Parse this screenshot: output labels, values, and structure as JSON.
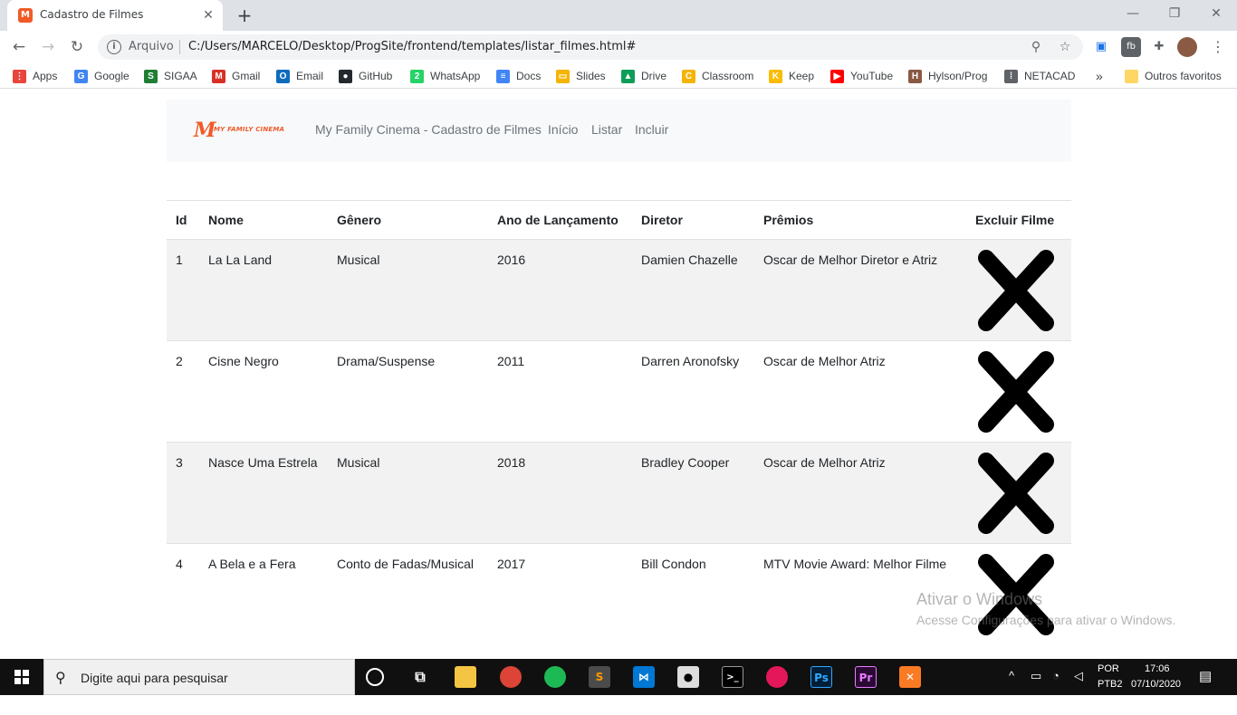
{
  "browser": {
    "tab_title": "Cadastro de Filmes",
    "tab_close": "✕",
    "new_tab": "+",
    "omnibox_scheme": "Arquivo",
    "url": "C:/Users/MARCELO/Desktop/ProgSite/frontend/templates/listar_filmes.html#",
    "bookmarks": [
      {
        "label": "Apps",
        "color": "#e8453c",
        "glyph": "⋮"
      },
      {
        "label": "Google",
        "color": "#4285f4",
        "glyph": "G"
      },
      {
        "label": "SIGAA",
        "color": "#1e7e34",
        "glyph": "S"
      },
      {
        "label": "Gmail",
        "color": "#d93025",
        "glyph": "M"
      },
      {
        "label": "Email",
        "color": "#0f6cbd",
        "glyph": "O"
      },
      {
        "label": "GitHub",
        "color": "#24292e",
        "glyph": "●"
      },
      {
        "label": "WhatsApp",
        "color": "#25d366",
        "glyph": "2"
      },
      {
        "label": "Docs",
        "color": "#4285f4",
        "glyph": "≡"
      },
      {
        "label": "Slides",
        "color": "#f4b400",
        "glyph": "▭"
      },
      {
        "label": "Drive",
        "color": "#0f9d58",
        "glyph": "▲"
      },
      {
        "label": "Classroom",
        "color": "#f4b400",
        "glyph": "C"
      },
      {
        "label": "Keep",
        "color": "#fbbc04",
        "glyph": "K"
      },
      {
        "label": "YouTube",
        "color": "#ff0000",
        "glyph": "▶"
      },
      {
        "label": "Hylson/Prog",
        "color": "#8a5a44",
        "glyph": "H"
      },
      {
        "label": "NETACAD",
        "color": "#5f6368",
        "glyph": "⁞"
      }
    ],
    "bookmarks_more": "»",
    "other_bookmarks": "Outros favoritos"
  },
  "site": {
    "logo_mark": "M",
    "logo_text": "MY FAMILY CINEMA",
    "brand": "My Family Cinema - Cadastro de Filmes",
    "nav": [
      "Início",
      "Listar",
      "Incluir"
    ]
  },
  "table": {
    "headers": [
      "Id",
      "Nome",
      "Gênero",
      "Ano de Lançamento",
      "Diretor",
      "Prêmios",
      "Excluir Filme"
    ],
    "rows": [
      [
        "1",
        "La La Land",
        "Musical",
        "2016",
        "Damien Chazelle",
        "Oscar de Melhor Diretor e Atriz"
      ],
      [
        "2",
        "Cisne Negro",
        "Drama/Suspense",
        "2011",
        "Darren Aronofsky",
        "Oscar de Melhor Atriz"
      ],
      [
        "3",
        "Nasce Uma Estrela",
        "Musical",
        "2018",
        "Bradley Cooper",
        "Oscar de Melhor Atriz"
      ],
      [
        "4",
        "A Bela e a Fera",
        "Conto de Fadas/Musical",
        "2017",
        "Bill Condon",
        "MTV Movie Award: Melhor Filme"
      ]
    ]
  },
  "watermark": {
    "title": "Ativar o Windows",
    "subtitle": "Acesse Configurações para ativar o Windows."
  },
  "taskbar": {
    "search_placeholder": "Digite aqui para pesquisar",
    "language_top": "POR",
    "language_bottom": "PTB2",
    "time": "17:06",
    "date": "07/10/2020"
  },
  "colors": {
    "accent": "#f05a28",
    "navbar_bg": "#f8f9fa",
    "row_stripe": "#f2f2f2"
  }
}
